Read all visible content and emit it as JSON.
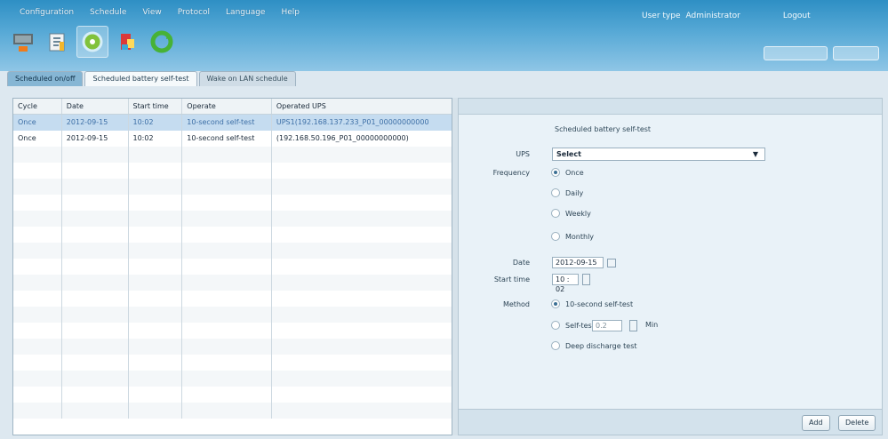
{
  "menu": [
    "Configuration",
    "Schedule",
    "View",
    "Protocol",
    "Language",
    "Help"
  ],
  "user": {
    "type_label": "User type",
    "type_value": "Administrator",
    "logout": "Logout"
  },
  "toolbar_icons": [
    "ups-monitor-icon",
    "settings-icon",
    "schedule-icon",
    "event-icon",
    "refresh-icon"
  ],
  "tabs": [
    "Scheduled on/off",
    "Scheduled battery self-test",
    "Wake on LAN schedule"
  ],
  "table": {
    "headers": [
      "Cycle",
      "Date",
      "Start time",
      "Operate",
      "Operated UPS"
    ],
    "rows": [
      [
        "Once",
        "2012-09-15",
        "10:02",
        "10-second self-test",
        "UPS1(192.168.137.233_P01_00000000000"
      ],
      [
        "Once",
        "2012-09-15",
        "10:02",
        "10-second self-test",
        "(192.168.50.196_P01_00000000000)"
      ]
    ]
  },
  "form": {
    "title": "Scheduled battery self-test",
    "ups_label": "UPS",
    "ups_value": "Select",
    "frequency_label": "Frequency",
    "frequency_options": [
      "Once",
      "Daily",
      "Weekly",
      "Monthly"
    ],
    "date_label": "Date",
    "date_value": "2012-09-15",
    "start_label": "Start time",
    "start_value": "10 : 02",
    "method_label": "Method",
    "method_options": [
      "10-second self-test",
      "Self-test",
      "Deep discharge test"
    ],
    "minutes_value": "0.2",
    "minutes_unit": "Min"
  },
  "actions": {
    "add": "Add",
    "delete": "Delete"
  }
}
